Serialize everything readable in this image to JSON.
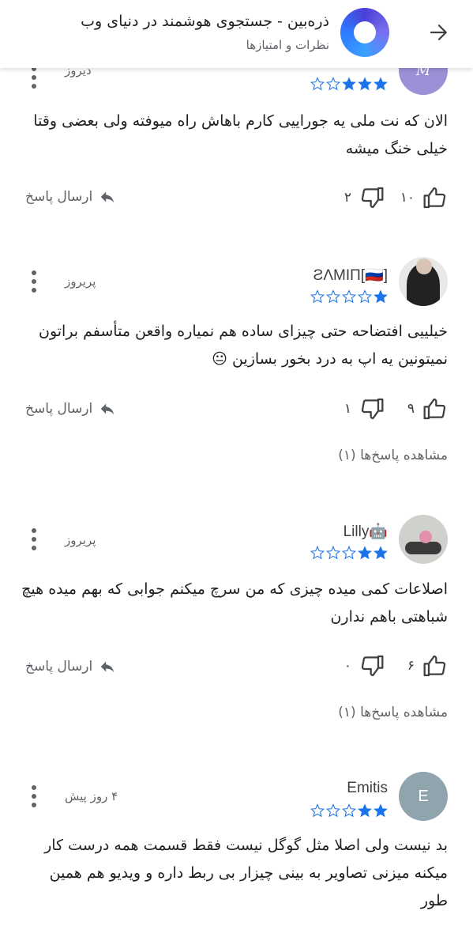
{
  "header": {
    "title": "ذره‌بین - جستجوی هوشمند در دنیای وب",
    "subtitle": "نظرات و امتیازها",
    "back_icon": "arrow-back-icon",
    "logo_icon": "app-logo-icon"
  },
  "labels": {
    "reply": "ارسال پاسخ",
    "reply_icon": "reply-icon",
    "like_icon": "thumbs-up-icon",
    "dislike_icon": "thumbs-down-icon",
    "more_icon": "more-vert-icon"
  },
  "colors": {
    "star_filled": "#1a73e8",
    "star_empty": "#1a73e8",
    "text_muted": "#5f6368"
  },
  "reviews": [
    {
      "author": "",
      "date": "دیروز",
      "rating": 3,
      "text": "الان که نت ملی یه جوراییی کارم باهاش راه میوفته ولی بعضی وقتا خیلی خنگ میشه",
      "likes": "۱۰",
      "dislikes": "۲",
      "view_replies": ""
    },
    {
      "author": "ƧΛMIП[🇷🇺]",
      "date": "پریروز",
      "rating": 1,
      "text": "خیلییی افتضاحه حتی چیزای ساده هم نمیاره واقعن متأسفم براتون نمیتونین یه اپ به درد بخور بسازین 😐",
      "likes": "۹",
      "dislikes": "۱",
      "view_replies": "مشاهده پاسخ‌ها (۱)"
    },
    {
      "author": "Lilly🤖",
      "date": "پریروز",
      "rating": 2,
      "text": "اصلاعات کمی میده چیزی که من سرچ میکنم جوابی که بهم میده هیچ شباهتی باهم ندارن",
      "likes": "۶",
      "dislikes": "۰",
      "view_replies": "مشاهده پاسخ‌ها (۱)"
    },
    {
      "author": "Emitis",
      "avatar_letter": "E",
      "date": "۴ روز پیش",
      "rating": 2,
      "text": "بد نیست ولی اصلا مثل گوگل نیست فقط قسمت همه درست کار میکنه میزنی تصاویر به بینی چیزار بی ربط داره و ویدیو هم همین طور",
      "likes": "",
      "dislikes": "",
      "view_replies": ""
    }
  ]
}
